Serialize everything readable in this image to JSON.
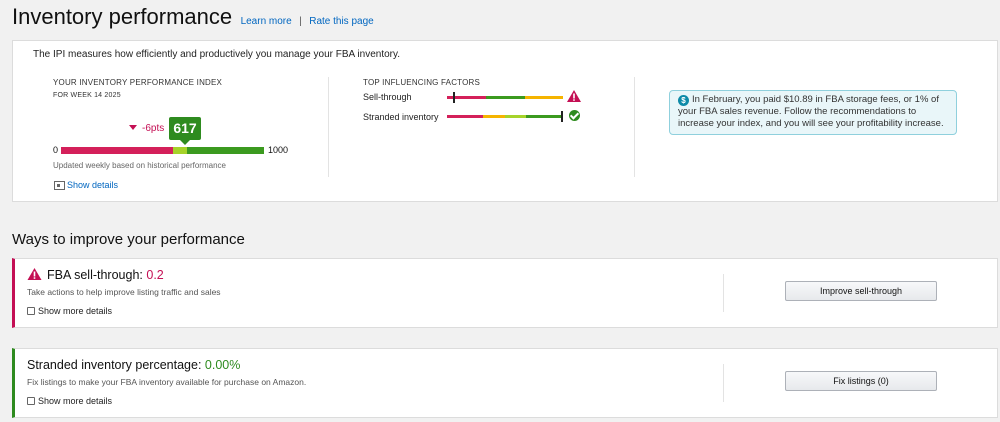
{
  "header": {
    "title": "Inventory performance",
    "learn_more": "Learn more",
    "separator": "|",
    "rate": "Rate this page"
  },
  "ipi": {
    "description": "The IPI measures how efficiently and productively you manage your FBA inventory.",
    "index_label": "YOUR INVENTORY PERFORMANCE INDEX",
    "week_label": "FOR WEEK 14 2025",
    "score": "617",
    "score_value": 617,
    "delta": "-6pts",
    "min": "0",
    "max": "1000",
    "updated": "Updated weekly based on historical performance",
    "show_details": "Show details",
    "gauge_segments": [
      {
        "from": 0,
        "to": 550,
        "color": "#d4205a"
      },
      {
        "from": 550,
        "to": 620,
        "color": "#a6d32a"
      },
      {
        "from": 620,
        "to": 1000,
        "color": "#3b9a1f"
      }
    ]
  },
  "factors": {
    "title": "TOP INFLUENCING FACTORS",
    "items": [
      {
        "label": "Sell-through",
        "status": "warning",
        "status_icon": "warning-icon",
        "marker": 0.06,
        "segments": [
          {
            "from": 0,
            "to": 0.34,
            "color": "#d4205a"
          },
          {
            "from": 0.34,
            "to": 0.67,
            "color": "#3b9a1f"
          },
          {
            "from": 0.67,
            "to": 1,
            "color": "#f5b400"
          }
        ]
      },
      {
        "label": "Stranded inventory",
        "status": "ok",
        "status_icon": "check-circle-icon",
        "marker": 0.99,
        "segments": [
          {
            "from": 0,
            "to": 0.31,
            "color": "#d4205a"
          },
          {
            "from": 0.31,
            "to": 0.5,
            "color": "#f5b400"
          },
          {
            "from": 0.5,
            "to": 0.68,
            "color": "#a6d32a"
          },
          {
            "from": 0.68,
            "to": 1,
            "color": "#3b9a1f"
          }
        ]
      }
    ]
  },
  "alert": {
    "icon": "dollar-icon",
    "icon_glyph": "$",
    "text": "In February, you paid $10.89 in FBA storage fees, or 1% of your FBA sales revenue. Follow the recommendations to increase your index, and you will see your profitability increase."
  },
  "improve": {
    "title": "Ways to improve your performance",
    "cards": [
      {
        "label": "FBA sell-through:",
        "value": "0.2",
        "subtitle": "Take actions to help improve listing traffic and sales",
        "more": "Show more details",
        "button": "Improve sell-through"
      },
      {
        "label": "Stranded inventory percentage:",
        "value": "0.00%",
        "subtitle": "Fix listings to make your FBA inventory available for purchase on Amazon.",
        "more": "Show more details",
        "button": "Fix listings (0)"
      }
    ]
  },
  "colors": {
    "accent_link": "#0066c0",
    "negative": "#c40f54",
    "positive": "#2e8b1f",
    "warning": "#f5b400"
  }
}
